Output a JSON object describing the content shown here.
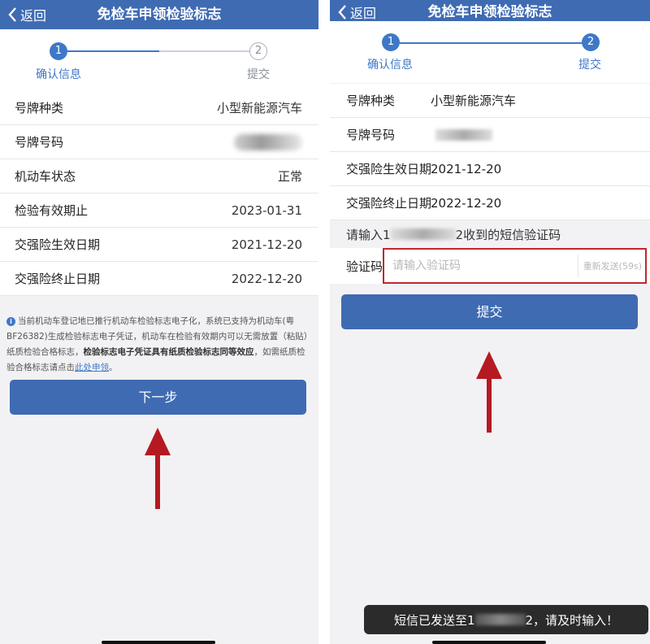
{
  "left": {
    "back_label": "返回",
    "title": "免检车申领检验标志",
    "steps": [
      {
        "num": "1",
        "label": "确认信息"
      },
      {
        "num": "2",
        "label": "提交"
      }
    ],
    "rows": [
      {
        "label": "号牌种类",
        "value": "小型新能源汽车"
      },
      {
        "label": "号牌号码",
        "value": ""
      },
      {
        "label": "机动车状态",
        "value": "正常"
      },
      {
        "label": "检验有效期止",
        "value": "2023-01-31"
      },
      {
        "label": "交强险生效日期",
        "value": "2021-12-20"
      },
      {
        "label": "交强险终止日期",
        "value": "2022-12-20"
      }
    ],
    "notice": {
      "icon": "i",
      "part1": "当前机动车登记地已推行机动车检验标志电子化，系统已支持为机动车(粤BF26382)生成检验标志电子凭证，机动车在检验有效期内可以无需放置（粘贴）纸质检验合格标志，",
      "bold": "检验标志电子凭证具有纸质检验标志同等效应",
      "part2": "，如需纸质检验合格标志请点击",
      "link": "此处申领",
      "end": "。"
    },
    "next_button": "下一步"
  },
  "right": {
    "back_label": "返回",
    "title": "免检车申领检验标志",
    "steps": [
      {
        "num": "1",
        "label": "确认信息"
      },
      {
        "num": "2",
        "label": "提交"
      }
    ],
    "rows": [
      {
        "label": "号牌种类",
        "value": "小型新能源汽车"
      },
      {
        "label": "号牌号码",
        "value": ""
      },
      {
        "label": "交强险生效日期",
        "value": "2021-12-20"
      },
      {
        "label": "交强险终止日期",
        "value": "2022-12-20"
      }
    ],
    "prompt_prefix": "请输入1",
    "prompt_suffix": "2收到的短信验证码",
    "code_label": "验证码",
    "code_placeholder": "请输入验证码",
    "resend_label": "重新发送(59s)",
    "submit_button": "提交",
    "toast_prefix": "短信已发送至1",
    "toast_suffix": "2，请及时输入！"
  },
  "colors": {
    "nav": "#3f6bb3",
    "accent": "#3f78c8",
    "arrow": "#b51a22",
    "highlight": "#c0282d"
  }
}
